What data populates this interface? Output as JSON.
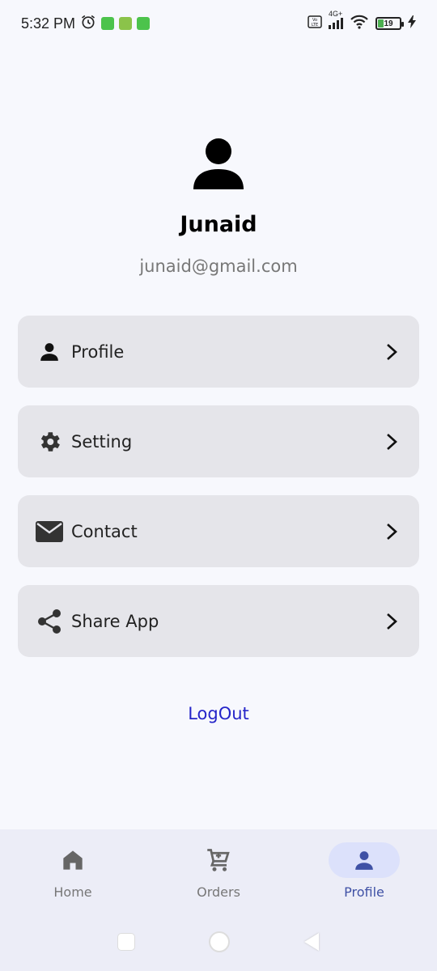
{
  "status_bar": {
    "time": "5:32 PM",
    "network": "4G+",
    "battery": "19",
    "notification_colors": [
      "#4cc34c",
      "#8bc34a",
      "#4cc34c"
    ]
  },
  "profile": {
    "name": "Junaid",
    "email": "junaid@gmail.com",
    "avatar_icon": "person-icon"
  },
  "menu": [
    {
      "label": "Profile",
      "icon": "person-icon"
    },
    {
      "label": "Setting",
      "icon": "gear-icon"
    },
    {
      "label": "Contact",
      "icon": "mail-icon"
    },
    {
      "label": "Share App",
      "icon": "share-icon"
    }
  ],
  "logout_label": "LogOut",
  "bottom_nav": [
    {
      "label": "Home",
      "icon": "home-icon",
      "active": false
    },
    {
      "label": "Orders",
      "icon": "cart-icon",
      "active": false
    },
    {
      "label": "Profile",
      "icon": "person-icon",
      "active": true
    }
  ],
  "colors": {
    "background": "#f7f8fd",
    "card": "#e5e5ea",
    "logout": "#2525c9",
    "nav_active": "#3f51a5",
    "nav_active_bg": "#dce1fb"
  }
}
